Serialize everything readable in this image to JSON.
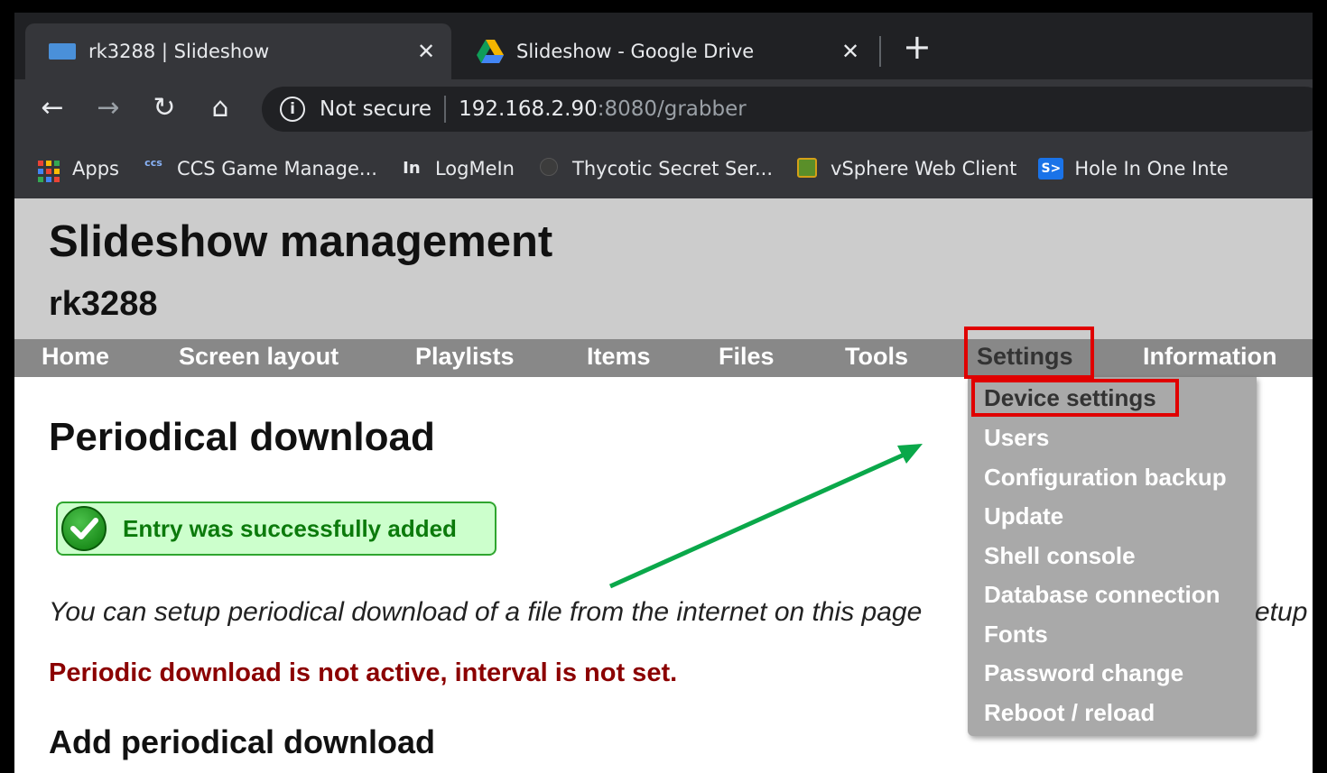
{
  "browser": {
    "tabs": [
      {
        "title": "rk3288 | Slideshow",
        "active": true
      },
      {
        "title": "Slideshow - Google Drive",
        "active": false
      }
    ],
    "new_tab": "+",
    "close_glyph": "✕",
    "address": {
      "security_label": "Not secure",
      "host": "192.168.2.90",
      "path": ":8080/grabber"
    },
    "bookmarks": [
      {
        "label": "Apps",
        "icon": "apps-grid-icon"
      },
      {
        "label": "CCS Game Manage...",
        "icon": "ccs-icon"
      },
      {
        "label": "LogMeIn",
        "icon": "logmein-icon"
      },
      {
        "label": "Thycotic Secret Ser...",
        "icon": "thycotic-icon"
      },
      {
        "label": "vSphere Web Client",
        "icon": "vsphere-icon"
      },
      {
        "label": "Hole In One Inte",
        "icon": "holeinone-icon"
      }
    ]
  },
  "page": {
    "site_title": "Slideshow management",
    "device_name": "rk3288",
    "menu": [
      "Home",
      "Screen layout",
      "Playlists",
      "Items",
      "Files",
      "Tools",
      "Settings",
      "Information"
    ],
    "settings_menu": [
      "Device settings",
      "Users",
      "Configuration backup",
      "Update",
      "Shell console",
      "Database connection",
      "Fonts",
      "Password change",
      "Reboot / reload"
    ],
    "content_title": "Periodical download",
    "success_message": "Entry was successfully added",
    "intro_text": "You can setup periodical download of a file from the internet on this page",
    "intro_tail": "etup",
    "warning": "Periodic download is not active, interval is not set.",
    "section_title": "Add periodical download"
  },
  "colors": {
    "highlight": "#e00000",
    "annotation_arrow": "#0aa84a",
    "menubar": "#888888",
    "header": "#cccccc",
    "warning": "#8b0000",
    "success_text": "#0b7a0b"
  }
}
